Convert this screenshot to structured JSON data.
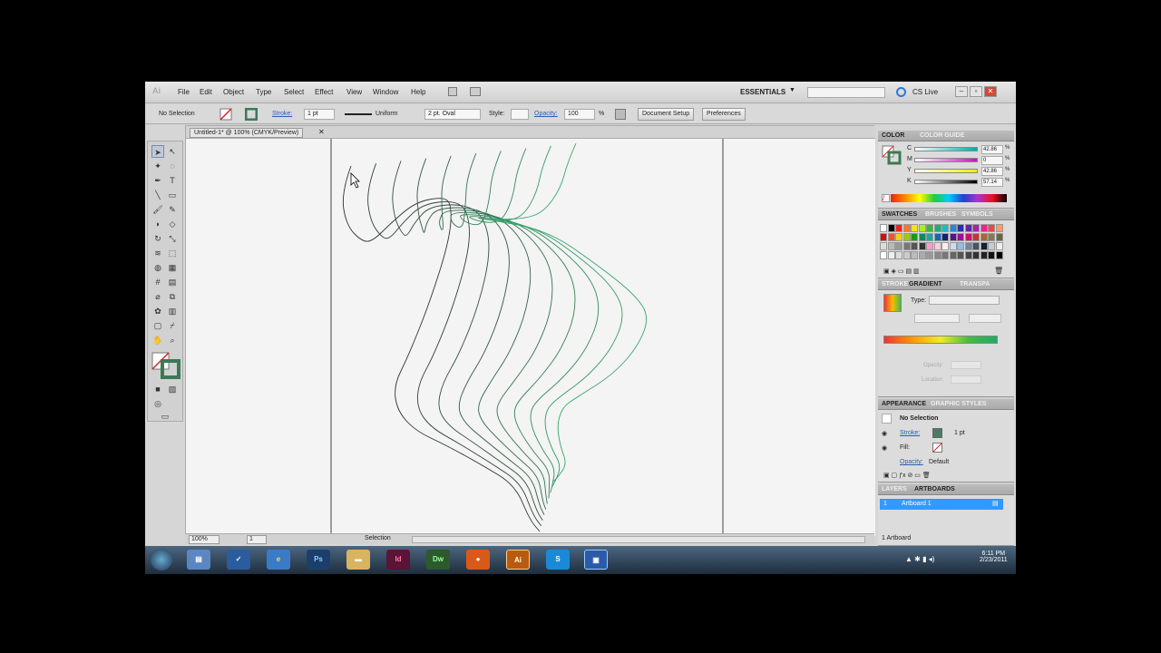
{
  "menubar": {
    "logo": "Ai",
    "items": [
      "File",
      "Edit",
      "Object",
      "Type",
      "Select",
      "Effect",
      "View",
      "Window",
      "Help"
    ],
    "workspace": "ESSENTIALS",
    "cslive": "CS Live"
  },
  "controlbar": {
    "selection": "No Selection",
    "stroke_label": "Stroke:",
    "stroke_weight": "1 pt",
    "profile": "Uniform",
    "brush": "2 pt. Oval",
    "style_label": "Style:",
    "opacity_label": "Opacity:",
    "opacity_value": "100",
    "opacity_unit": "%",
    "document_setup": "Document Setup",
    "preferences": "Preferences"
  },
  "document": {
    "tab_title": "Untitled-1* @ 100% (CMYK/Preview)",
    "zoom": "100%",
    "page": "1",
    "status_tool": "Selection"
  },
  "panels": {
    "color": {
      "tabs": [
        "COLOR",
        "COLOR GUIDE"
      ],
      "sliders": [
        {
          "label": "C",
          "value": "42.86"
        },
        {
          "label": "M",
          "value": "0"
        },
        {
          "label": "Y",
          "value": "42.86"
        },
        {
          "label": "K",
          "value": "57.14"
        }
      ],
      "unit": "%"
    },
    "swatches": {
      "tabs": [
        "SWATCHES",
        "BRUSHES",
        "SYMBOLS"
      ]
    },
    "gradient": {
      "tabs": [
        "STROKE",
        "GRADIENT",
        "TRANSPA"
      ],
      "type_label": "Type:",
      "opacity_label": "Opacity:",
      "location_label": "Location:"
    },
    "appearance": {
      "tabs": [
        "APPEARANCE",
        "GRAPHIC STYLES"
      ],
      "title": "No Selection",
      "stroke_label": "Stroke:",
      "stroke_value": "1 pt",
      "fill_label": "Fill:",
      "opacity_label": "Opacity:",
      "opacity_value": "Default"
    },
    "layers": {
      "tabs": [
        "LAYERS",
        "ARTBOARDS"
      ],
      "row_num": "1",
      "row_name": "Artboard 1",
      "footer": "1 Artboard"
    }
  },
  "taskbar": {
    "apps": [
      "Ps",
      "Id",
      "Dw",
      "Ai"
    ],
    "time": "6:11 PM",
    "date": "2/23/2011"
  },
  "colors": {
    "accent": "#3a8ee6",
    "selection_row": "#3399ff",
    "stroke_green": "#3aa66e"
  }
}
